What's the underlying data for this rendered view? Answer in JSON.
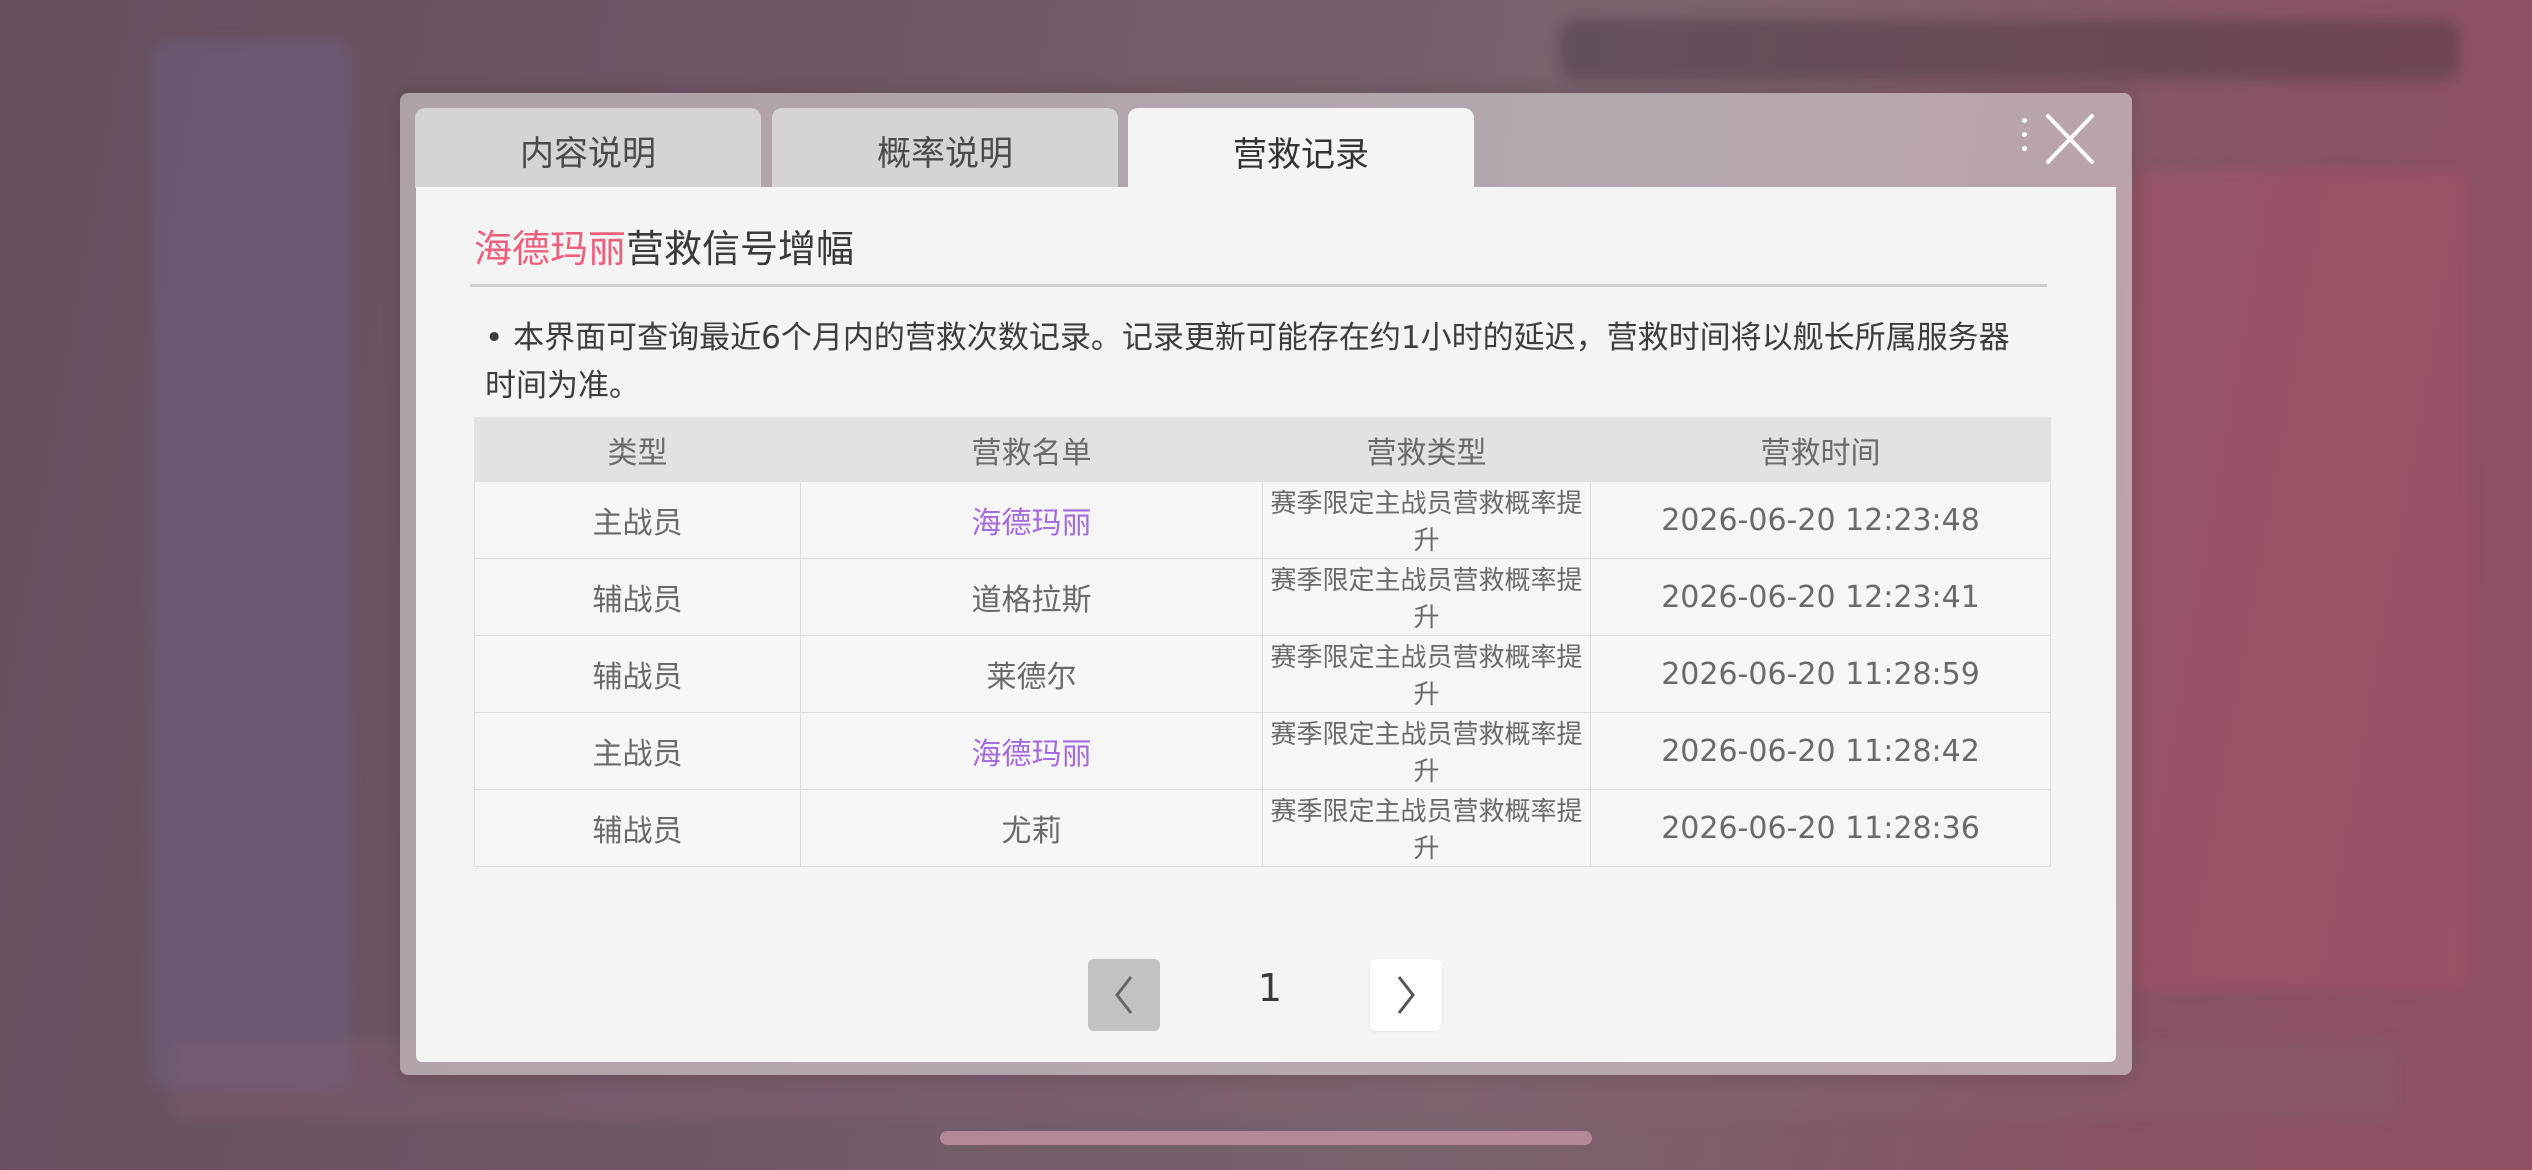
{
  "tabs": [
    {
      "label": "内容说明",
      "active": false
    },
    {
      "label": "概率说明",
      "active": false
    },
    {
      "label": "营救记录",
      "active": true
    }
  ],
  "heading": {
    "highlight": "海德玛丽",
    "rest": "营救信号增幅"
  },
  "notice": "• 本界面可查询最近6个月内的营救次数记录。记录更新可能存在约1小时的延迟，营救时间将以舰长所属服务器时间为准。",
  "table": {
    "columns": [
      "类型",
      "营救名单",
      "营救类型",
      "营救时间"
    ],
    "rows": [
      {
        "type": "主战员",
        "name": "海德玛丽",
        "rescue_type": "赛季限定主战员营救概率提升",
        "time": "2026-06-20 12:23:48",
        "highlight": true
      },
      {
        "type": "辅战员",
        "name": "道格拉斯",
        "rescue_type": "赛季限定主战员营救概率提升",
        "time": "2026-06-20 12:23:41",
        "highlight": false
      },
      {
        "type": "辅战员",
        "name": "莱德尔",
        "rescue_type": "赛季限定主战员营救概率提升",
        "time": "2026-06-20 11:28:59",
        "highlight": false
      },
      {
        "type": "主战员",
        "name": "海德玛丽",
        "rescue_type": "赛季限定主战员营救概率提升",
        "time": "2026-06-20 11:28:42",
        "highlight": true
      },
      {
        "type": "辅战员",
        "name": "尤莉",
        "rescue_type": "赛季限定主战员营救概率提升",
        "time": "2026-06-20 11:28:36",
        "highlight": false
      }
    ]
  },
  "pagination": {
    "current_page": "1",
    "prev_icon": "chevron-left-icon",
    "next_icon": "chevron-right-icon"
  },
  "colors": {
    "highlight_name": "#ee5f7d",
    "main_member": "#a46be0",
    "active_tab": "#f4f4f4",
    "inactive_tab": "#d6d3d6"
  }
}
